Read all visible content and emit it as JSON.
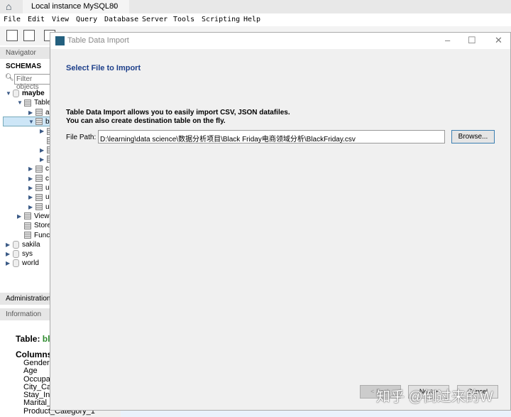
{
  "tab": {
    "title": "Local instance MySQL80",
    "close": "×"
  },
  "menu": [
    "File",
    "Edit",
    "View",
    "Query",
    "Database",
    "Server",
    "Tools",
    "Scripting",
    "Help"
  ],
  "navigator": {
    "header": "Navigator",
    "schemas_label": "SCHEMAS",
    "filter_placeholder": "Filter objects",
    "tree": [
      {
        "label": "maybe",
        "level": 0,
        "type": "db",
        "expanded": true,
        "bold": true
      },
      {
        "label": "Tables",
        "level": 1,
        "type": "folder",
        "expanded": true
      },
      {
        "label": "a",
        "level": 2,
        "type": "table",
        "expanded": false
      },
      {
        "label": "b",
        "level": 2,
        "type": "table",
        "expanded": true,
        "selected": true
      },
      {
        "label": "",
        "level": 3,
        "type": "folder",
        "expanded": false
      },
      {
        "label": "",
        "level": 3,
        "type": "folder",
        "leaf": true
      },
      {
        "label": "",
        "level": 3,
        "type": "folder",
        "expanded": false
      },
      {
        "label": "",
        "level": 3,
        "type": "folder",
        "expanded": false
      },
      {
        "label": "c",
        "level": 2,
        "type": "table",
        "expanded": false
      },
      {
        "label": "c",
        "level": 2,
        "type": "table",
        "expanded": false
      },
      {
        "label": "u",
        "level": 2,
        "type": "table",
        "expanded": false
      },
      {
        "label": "u",
        "level": 2,
        "type": "table",
        "expanded": false
      },
      {
        "label": "u",
        "level": 2,
        "type": "table",
        "expanded": false
      },
      {
        "label": "Views",
        "level": 1,
        "type": "folder",
        "expanded": false
      },
      {
        "label": "Stored Procedures",
        "level": 1,
        "type": "folder",
        "leaf": true
      },
      {
        "label": "Functions",
        "level": 1,
        "type": "folder",
        "leaf": true
      },
      {
        "label": "sakila",
        "level": 0,
        "type": "db",
        "expanded": false
      },
      {
        "label": "sys",
        "level": 0,
        "type": "db",
        "expanded": false
      },
      {
        "label": "world",
        "level": 0,
        "type": "db",
        "expanded": false
      }
    ]
  },
  "administration_tab": "Administration",
  "information": {
    "header": "Information",
    "table_label": "Table:",
    "table_name": "bla",
    "columns_label": "Columns:",
    "columns": [
      "Gender",
      "Age",
      "Occupation",
      "City_Category",
      "Stay_In_Current_City_Years",
      "Marital_Status",
      "Product_Category_1"
    ]
  },
  "dialog": {
    "title": "Table Data Import",
    "heading": "Select File to Import",
    "description_line1": "Table Data Import allows you to easily import CSV, JSON datafiles.",
    "description_line2": "You can also create destination table on the fly.",
    "file_path_label": "File Path:",
    "file_path_value": "D:\\learning\\data science\\数据分析项目\\Black Friday电商领域分析\\BlackFriday.csv",
    "browse": "Browse...",
    "back": "< Back",
    "next": "Next >",
    "cancel": "Cancel"
  },
  "watermark": "知乎 @倒过来的W",
  "colors": {
    "heading": "#1d3f8a",
    "table_name": "#2e8b2e",
    "selection": "#cde6f7"
  }
}
